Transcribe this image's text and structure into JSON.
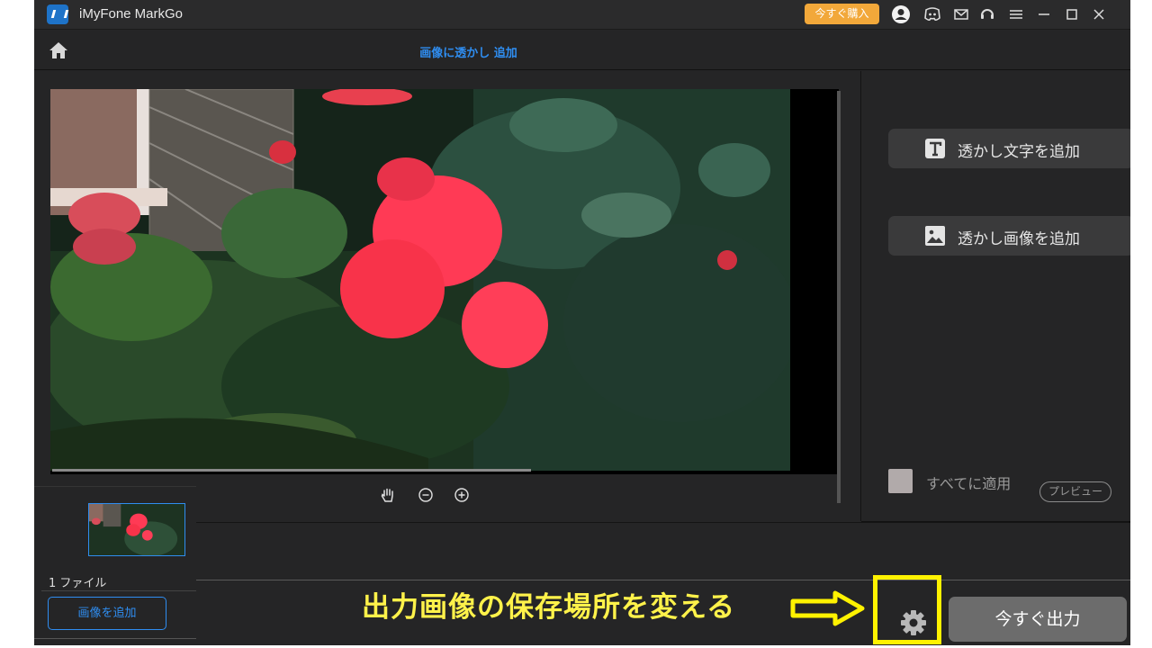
{
  "app": {
    "title": "iMyFone MarkGo",
    "buy_label": "今すぐ購入"
  },
  "nav": {
    "page_title": "画像に透かし 追加"
  },
  "right_panel": {
    "add_text_label": "透かし文字を追加",
    "add_image_label": "透かし画像を追加",
    "apply_all_label": "すべてに適用",
    "preview_label": "プレビュー"
  },
  "file_strip": {
    "file_count": "1 ファイル",
    "add_image_label": "画像を追加"
  },
  "bottom": {
    "annotation": "出力画像の保存場所を変える",
    "export_label": "今すぐ出力"
  },
  "colors": {
    "accent": "#2f8df0",
    "buy": "#f2a83a",
    "highlight": "#fff200",
    "background": "#252526"
  }
}
